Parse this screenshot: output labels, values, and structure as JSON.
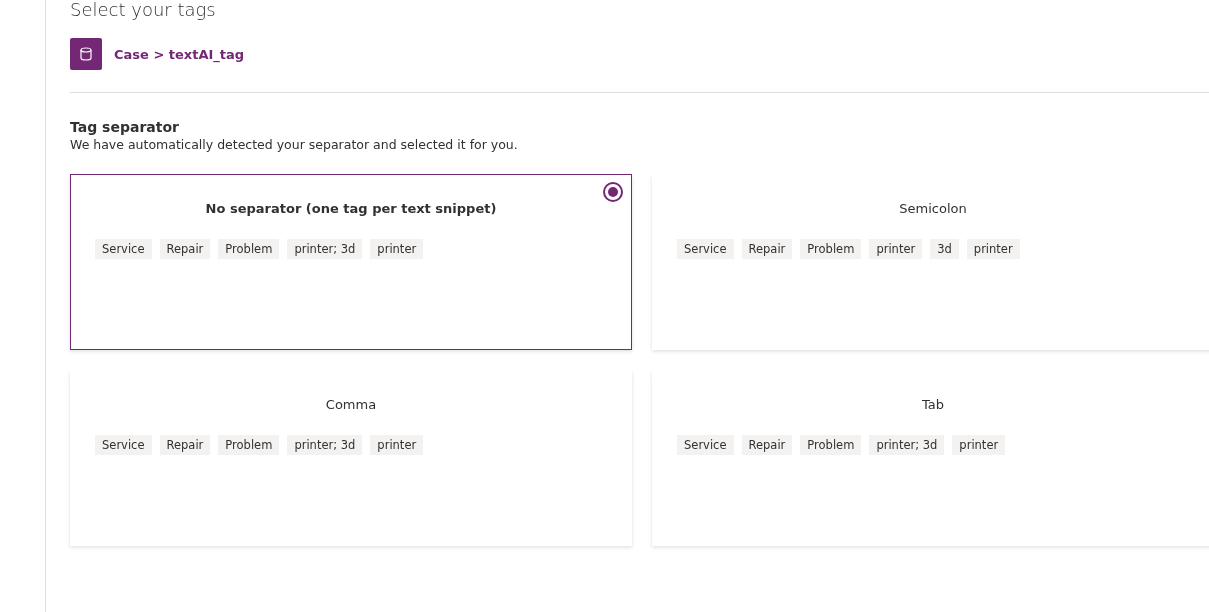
{
  "page_title": "Select your tags",
  "source": {
    "path": "Case > textAI_tag"
  },
  "section": {
    "title": "Tag separator",
    "description": "We have automatically detected your separator and selected it for you."
  },
  "options": [
    {
      "label": "No separator (one tag per text snippet)",
      "selected": true,
      "tags": [
        "Service",
        "Repair",
        "Problem",
        "printer; 3d",
        "printer"
      ]
    },
    {
      "label": "Semicolon",
      "selected": false,
      "tags": [
        "Service",
        "Repair",
        "Problem",
        "printer",
        "3d",
        "printer"
      ]
    },
    {
      "label": "Comma",
      "selected": false,
      "tags": [
        "Service",
        "Repair",
        "Problem",
        "printer; 3d",
        "printer"
      ]
    },
    {
      "label": "Tab",
      "selected": false,
      "tags": [
        "Service",
        "Repair",
        "Problem",
        "printer; 3d",
        "printer"
      ]
    }
  ]
}
